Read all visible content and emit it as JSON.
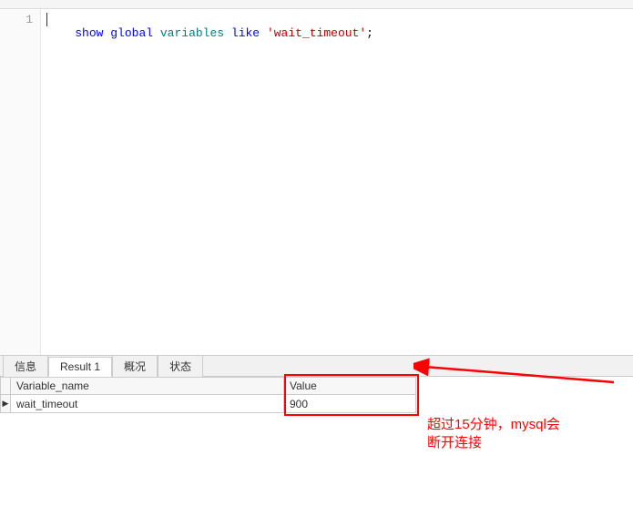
{
  "editor": {
    "line_numbers": [
      "1"
    ],
    "code": {
      "kw_show": "show",
      "kw_global": "global",
      "kw_variables": "variables",
      "kw_like": "like",
      "str_literal": "'wait_timeout'",
      "semi": ";"
    }
  },
  "tabs": [
    {
      "label": "信息",
      "active": false
    },
    {
      "label": "Result 1",
      "active": true
    },
    {
      "label": "概况",
      "active": false
    },
    {
      "label": "状态",
      "active": false
    }
  ],
  "results": {
    "columns": [
      "Variable_name",
      "Value"
    ],
    "rows": [
      {
        "Variable_name": "wait_timeout",
        "Value": "900"
      }
    ]
  },
  "annotation": {
    "text_line1": "超过15分钟，mysql会",
    "text_line2": "断开连接"
  }
}
